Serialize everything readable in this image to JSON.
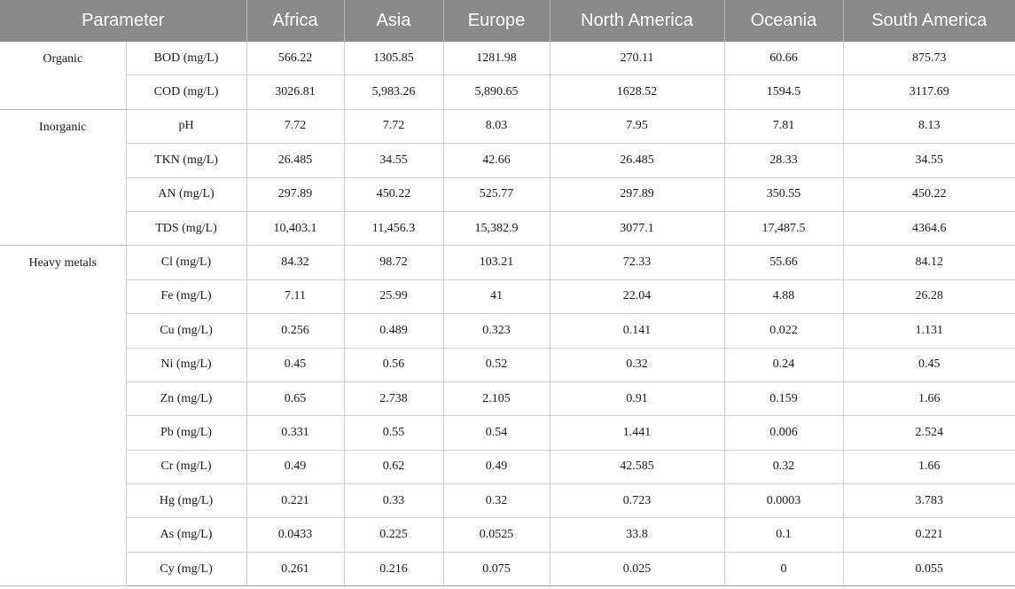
{
  "table": {
    "headers": [
      "Parameter",
      "Africa",
      "Asia",
      "Europe",
      "North America",
      "Oceania",
      "South America"
    ],
    "groups": [
      {
        "name": "Organic",
        "rows": [
          {
            "param": "BOD (mg/L)",
            "values": [
              "566.22",
              "1305.85",
              "1281.98",
              "270.11",
              "60.66",
              "875.73"
            ]
          },
          {
            "param": "COD (mg/L)",
            "values": [
              "3026.81",
              "5,983.26",
              "5,890.65",
              "1628.52",
              "1594.5",
              "3117.69"
            ]
          }
        ]
      },
      {
        "name": "Inorganic",
        "rows": [
          {
            "param": "pH",
            "values": [
              "7.72",
              "7.72",
              "8.03",
              "7.95",
              "7.81",
              "8.13"
            ]
          },
          {
            "param": "TKN (mg/L)",
            "values": [
              "26.485",
              "34.55",
              "42.66",
              "26.485",
              "28.33",
              "34.55"
            ]
          },
          {
            "param": "AN (mg/L)",
            "values": [
              "297.89",
              "450.22",
              "525.77",
              "297.89",
              "350.55",
              "450.22"
            ]
          },
          {
            "param": "TDS (mg/L)",
            "values": [
              "10,403.1",
              "11,456.3",
              "15,382.9",
              "3077.1",
              "17,487.5",
              "4364.6"
            ]
          }
        ]
      },
      {
        "name": "Heavy metals",
        "rows": [
          {
            "param": "Cl (mg/L)",
            "values": [
              "84.32",
              "98.72",
              "103.21",
              "72.33",
              "55.66",
              "84.12"
            ]
          },
          {
            "param": "Fe (mg/L)",
            "values": [
              "7.11",
              "25.99",
              "41",
              "22.04",
              "4.88",
              "26.28"
            ]
          },
          {
            "param": "Cu (mg/L)",
            "values": [
              "0.256",
              "0.489",
              "0.323",
              "0.141",
              "0.022",
              "1.131"
            ]
          },
          {
            "param": "Ni (mg/L)",
            "values": [
              "0.45",
              "0.56",
              "0.52",
              "0.32",
              "0.24",
              "0.45"
            ]
          },
          {
            "param": "Zn (mg/L)",
            "values": [
              "0.65",
              "2.738",
              "2.105",
              "0.91",
              "0.159",
              "1.66"
            ]
          },
          {
            "param": "Pb (mg/L)",
            "values": [
              "0.331",
              "0.55",
              "0.54",
              "1.441",
              "0.006",
              "2.524"
            ]
          },
          {
            "param": "Cr (mg/L)",
            "values": [
              "0.49",
              "0.62",
              "0.49",
              "42.585",
              "0.32",
              "1.66"
            ]
          },
          {
            "param": "Hg (mg/L)",
            "values": [
              "0.221",
              "0.33",
              "0.32",
              "0.723",
              "0.0003",
              "3.783"
            ]
          },
          {
            "param": "As (mg/L)",
            "values": [
              "0.0433",
              "0.225",
              "0.0525",
              "33.8",
              "0.1",
              "0.221"
            ]
          },
          {
            "param": "Cy (mg/L)",
            "values": [
              "0.261",
              "0.216",
              "0.075",
              "0.025",
              "0",
              "0.055"
            ]
          }
        ]
      }
    ]
  }
}
